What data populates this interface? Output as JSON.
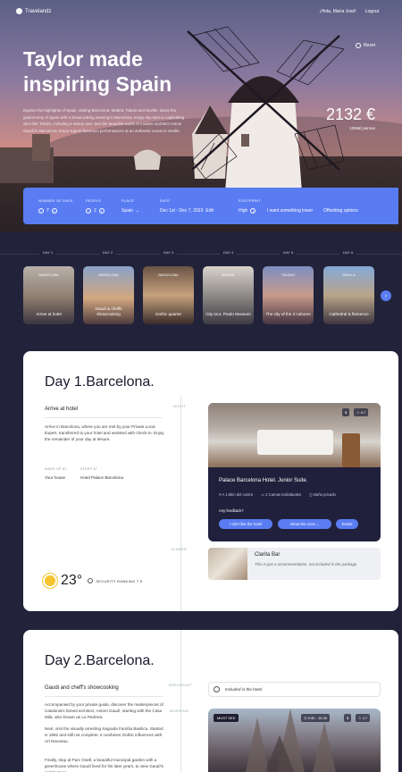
{
  "brand": "Travelandz",
  "nav": {
    "greeting": "¡Hola, María José!",
    "logout": "Logout"
  },
  "hero": {
    "reset": "Reset",
    "title": "Taylor made inspiring Spain",
    "description": "Explore the highlights of Spain, visiting Barcelona, Madrid, Toledo and Seville. Savor the gastronomy of Spain with a showcooking evening in Barcelona. Enjoy day trips to captivating sites like Toledo, including a winery tour. See the beautiful works of modern architect Antoni Gaudí in Barcelona. Enjoy superb flamenco performances at an authentic venue in Seville.",
    "price": "2132 €",
    "price_sub": "1066€/ person"
  },
  "booking": {
    "days_label": "NUMBER OF DAYS",
    "days_value": "7",
    "people_label": "PEOPLE",
    "people_value": "2",
    "place_label": "PLACE",
    "place_value": "Spain",
    "date_label": "DATE",
    "date_value": "Dec 1st - Dec 7, 2023",
    "date_edit": "Edit",
    "footprint_label": "FOOTPRINT",
    "footprint_value": "High",
    "lower": "I want something lower",
    "offset": "Offsetting options"
  },
  "days": [
    {
      "label": "DAY 1",
      "city": "BARCELONA",
      "text": "Arrive at hotel"
    },
    {
      "label": "DAY 2",
      "city": "BARCELONA",
      "text": "Gaudi & cheffs showcooking"
    },
    {
      "label": "DAY 3",
      "city": "BARCELONA",
      "text": "Gothic quarter"
    },
    {
      "label": "DAY 4",
      "city": "MADRID",
      "text": "City tour, Prado Museum"
    },
    {
      "label": "DAY 5",
      "city": "TOLEDO",
      "text": "The city of the 3 cultures"
    },
    {
      "label": "DAY 6",
      "city": "SEVILLA",
      "text": "Cathedral & flamenco"
    }
  ],
  "day1": {
    "title": "Day 1.Barcelona.",
    "tag_night": "NIGHT",
    "tag_dinner": "DINNER",
    "subtitle": "Arrive at hotel",
    "body": "Arrive in Barcelona, where you are met by your Private Local Expert, transferred to your hotel and assisted with check-in. Enjoy the remainder of your day at leisure.",
    "wake_label": "WAKE UP AT",
    "wake_value": "Your house",
    "sleep_label": "SLEEP AT",
    "sleep_value": "Hotel Palace Barcelona",
    "hotel": {
      "price_badge": "$",
      "rating": "4.7",
      "name": "Palace Barcelona Hotel. Junior Suite.",
      "features": [
        "A 1,6km del centro",
        "2 Camas individuales",
        "Baño privado"
      ],
      "feedback": "Any feedback?",
      "btn1": "I don't like the hotel",
      "btn2": "About the room",
      "btn3": "Extras"
    },
    "bar": {
      "name": "Clarita Bar",
      "desc": "This is just a recommendation, not included in the package."
    },
    "temperature": "23°",
    "security": "SECURITY RANKING 7.5"
  },
  "day2": {
    "title": "Day 2.Barcelona.",
    "tag_breakfast": "BREAKFAST",
    "tag_morning": "MORNING",
    "subtitle": "Gaudi and cheff's showcooking",
    "p1": "Accompanied by your private guide, discover the masterpieces of Catalonia's famed architect, Antoni Gaudí, starting with the Casa Milà, also known as La Pedrera.",
    "p2": "Next, visit the visually arresting Sagrada Família Basilica. Started in 1882 and still not complete, it combines Gothic influences with Art Nouveau.",
    "p3": "Finally, stop at Parc Güell, a beautiful municipal garden with a greenhouse where Gaudí lived for his later years, to view Gaudí's architecture...",
    "included": "Included in the hotel",
    "must_see": "MUST SEE",
    "time": "9:30 - 10:30",
    "price": "$",
    "rating": "4.7"
  },
  "colors": {
    "accent": "#5a7cf3",
    "dark": "#22223a"
  }
}
